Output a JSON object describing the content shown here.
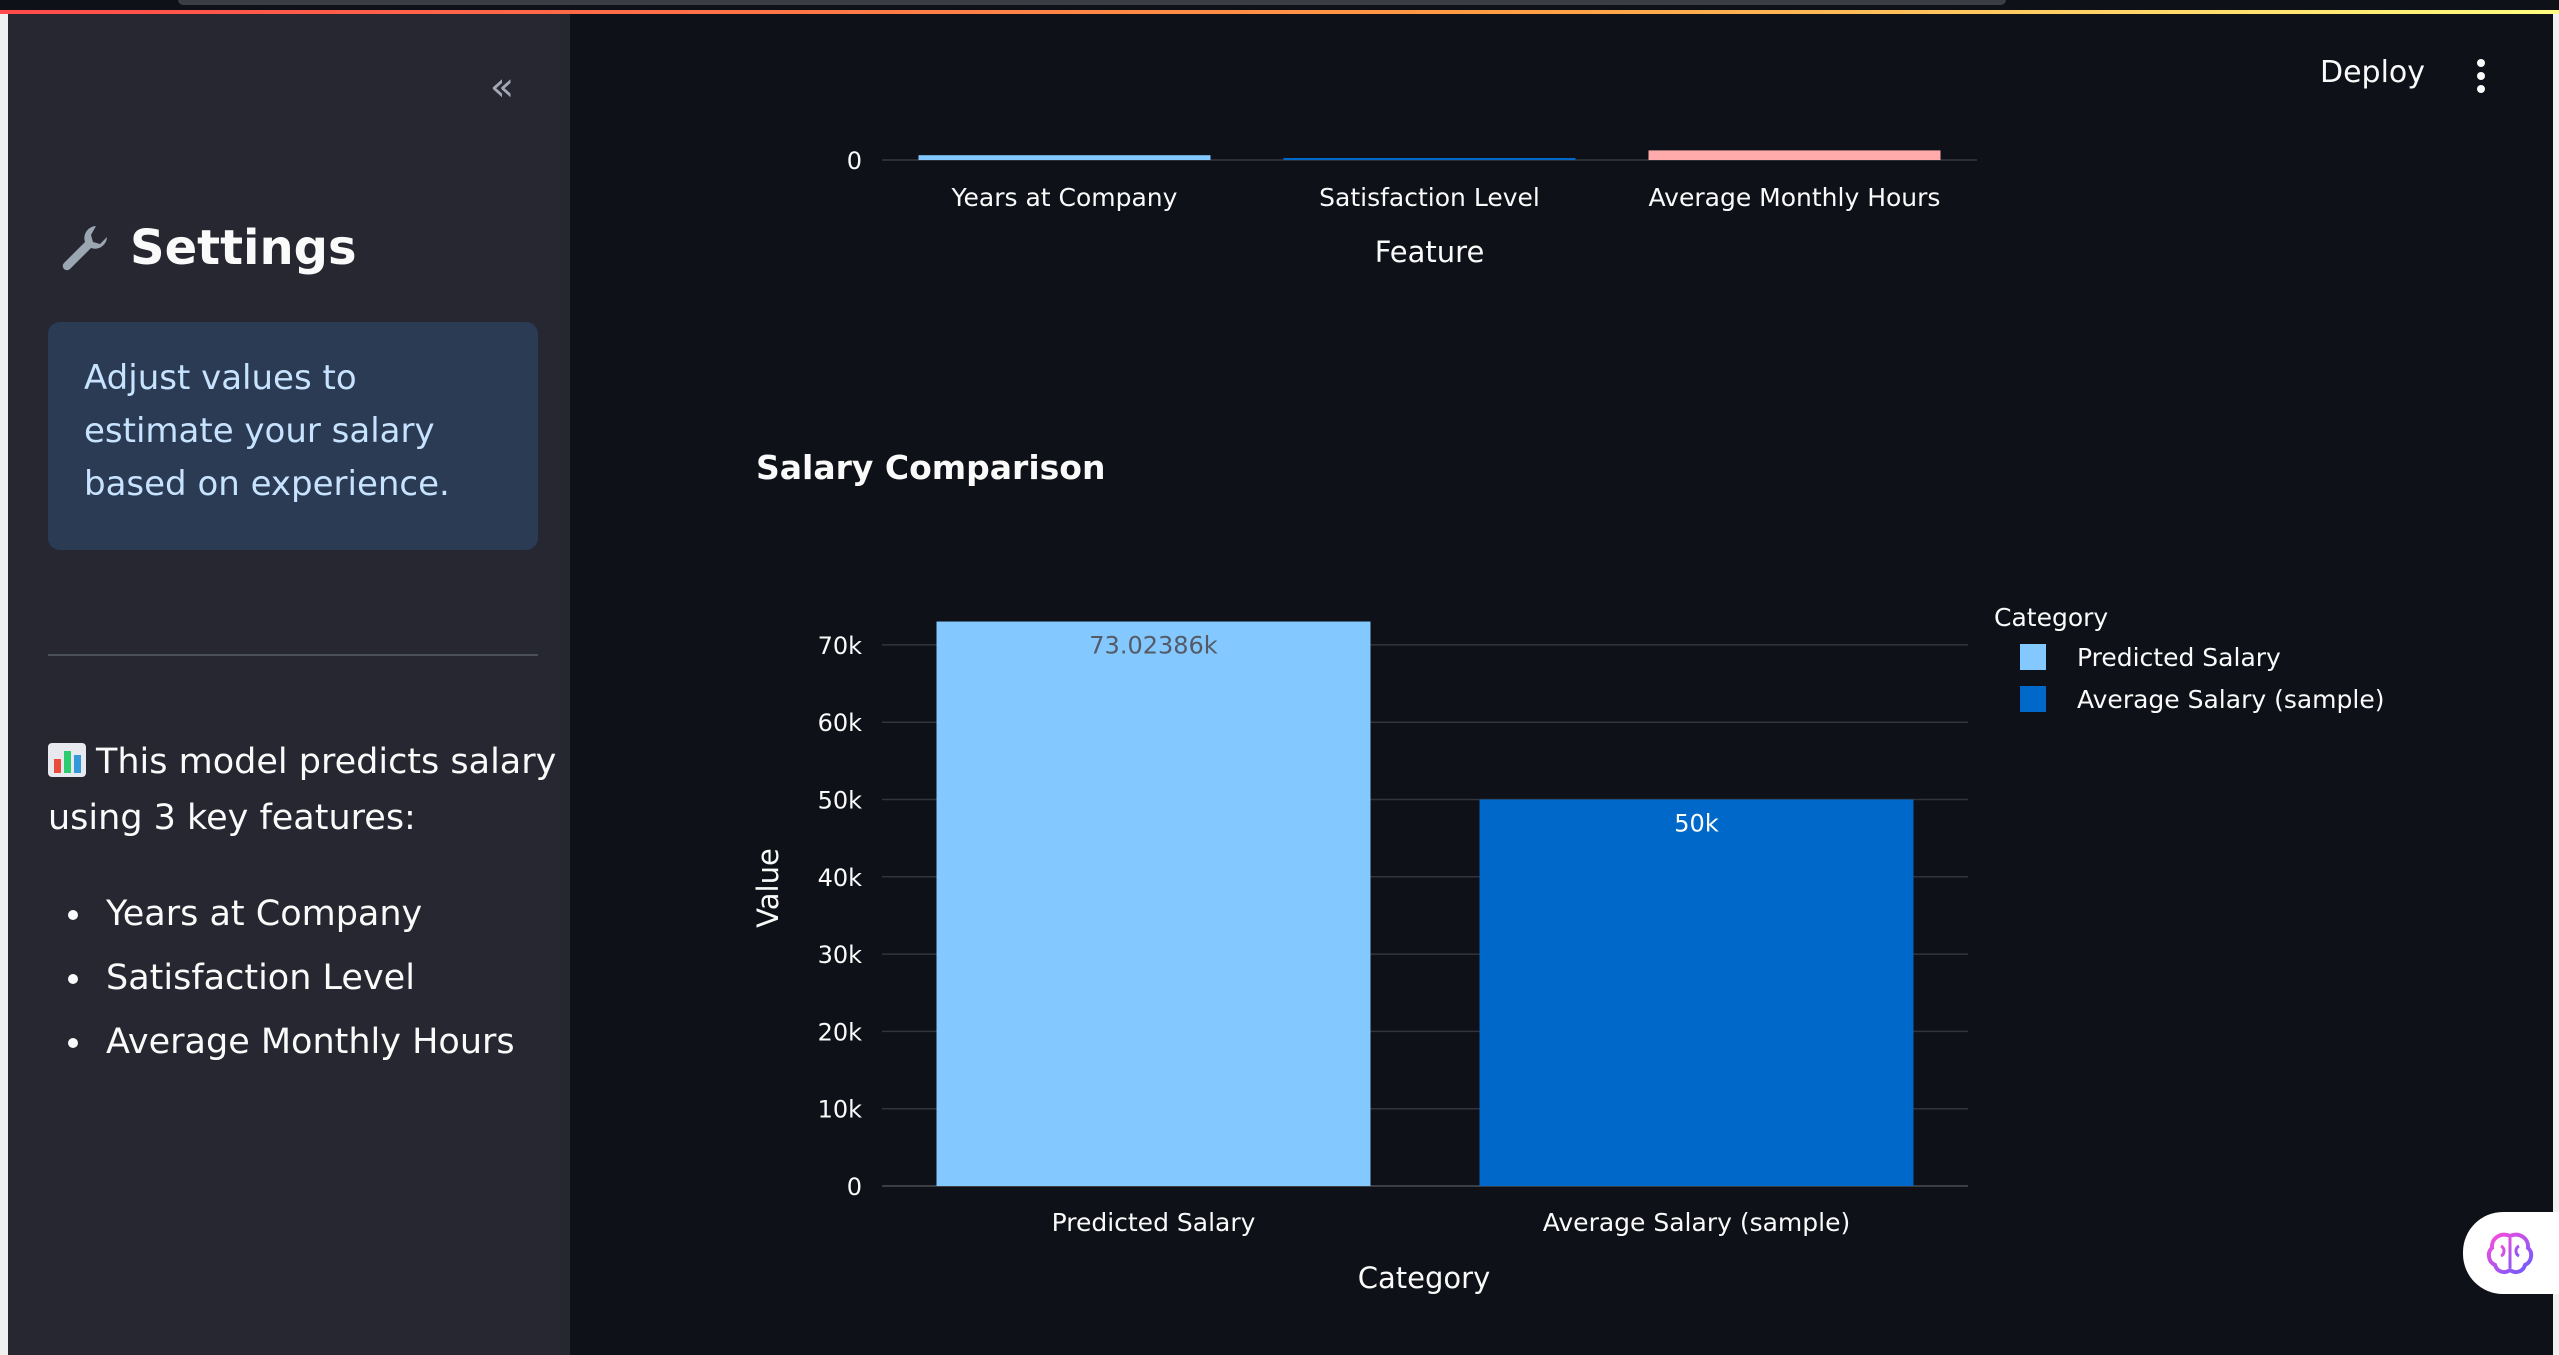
{
  "sidebar": {
    "collapse_glyph": "«",
    "title": "Settings",
    "title_icon": "wrench-icon",
    "info_text": "Adjust values to estimate your salary based on experience.",
    "description": "This model predicts salary using 3 key features:",
    "description_icon": "bar-chart-icon",
    "features": [
      "Years at Company",
      "Satisfaction Level",
      "Average Monthly Hours"
    ]
  },
  "header": {
    "deploy_label": "Deploy",
    "menu_icon": "vertical-dots-icon"
  },
  "main": {
    "section_title": "Salary Comparison"
  },
  "colors": {
    "background": "#0e1117",
    "sidebar": "#262730",
    "info_bg": "#2b3b53",
    "light_blue": "#83c9ff",
    "dark_blue": "#0068c9",
    "pink": "#ffabab"
  },
  "chart_data": [
    {
      "type": "bar",
      "note": "partially visible chart, scrolled off the top",
      "categories": [
        "Years at Company",
        "Satisfaction Level",
        "Average Monthly Hours"
      ],
      "colors": [
        "#83c9ff",
        "#0068c9",
        "#ffabab"
      ],
      "values": [
        0.15,
        0.01,
        0.3
      ],
      "xlabel": "Feature",
      "y_tick_labels": [
        "0"
      ]
    },
    {
      "type": "bar",
      "title": "Salary Comparison",
      "categories": [
        "Predicted Salary",
        "Average Salary (sample)"
      ],
      "values": [
        73023.86,
        50000
      ],
      "data_labels": [
        "73.02386k",
        "50k"
      ],
      "colors": [
        "#83c9ff",
        "#0068c9"
      ],
      "xlabel": "Category",
      "ylabel": "Value",
      "ylim": [
        0,
        73023.86
      ],
      "y_ticks": [
        0,
        10000,
        20000,
        30000,
        40000,
        50000,
        60000,
        70000
      ],
      "y_tick_labels": [
        "0",
        "10k",
        "20k",
        "30k",
        "40k",
        "50k",
        "60k",
        "70k"
      ],
      "grid": true,
      "legend": {
        "title": "Category",
        "position": "right",
        "entries": [
          "Predicted Salary",
          "Average Salary (sample)"
        ]
      }
    }
  ]
}
